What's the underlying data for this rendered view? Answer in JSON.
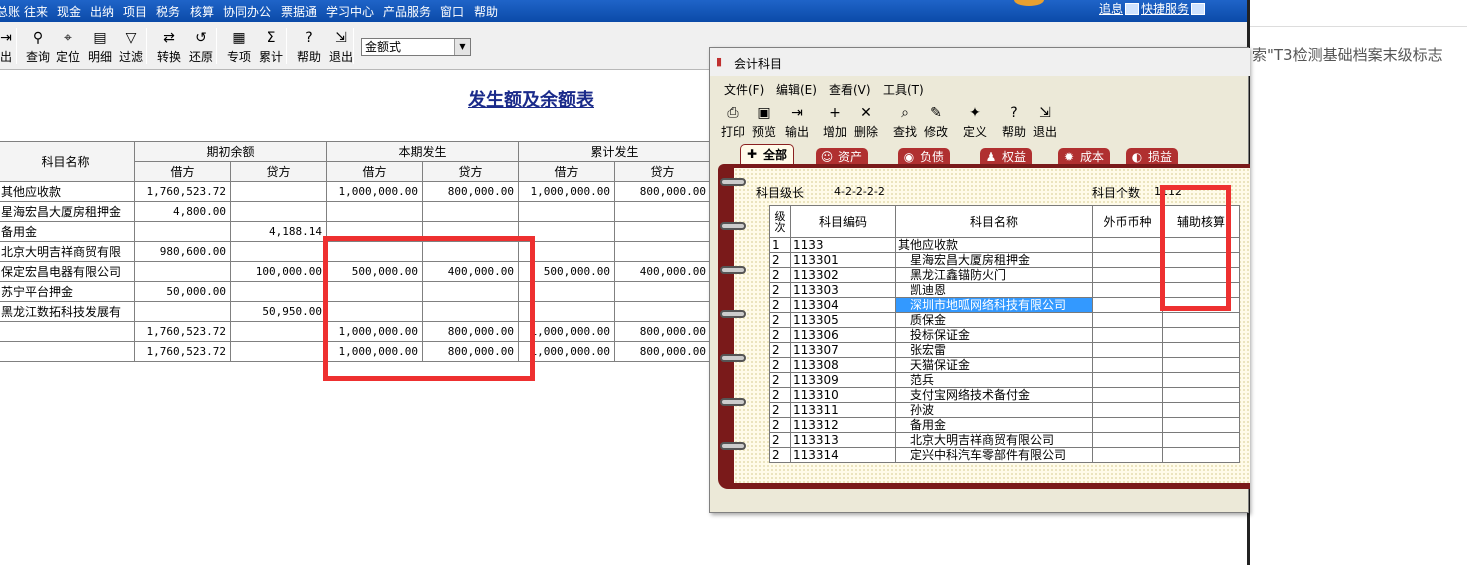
{
  "menu": {
    "items": [
      "总账",
      "往来",
      "现金",
      "出纳",
      "项目",
      "税务",
      "核算",
      "协同办公",
      "票据通",
      "学习中心",
      "产品服务",
      "窗口",
      "帮助"
    ],
    "news": "追息",
    "quick_service": "快捷服务"
  },
  "toolbar": {
    "buttons": [
      {
        "label": "出",
        "icon": "output-icon"
      },
      {
        "label": "查询",
        "icon": "binoculars-icon"
      },
      {
        "label": "定位",
        "icon": "locate-icon"
      },
      {
        "label": "明细",
        "icon": "detail-icon"
      },
      {
        "label": "过滤",
        "icon": "filter-icon"
      },
      {
        "label": "转换",
        "icon": "convert-icon"
      },
      {
        "label": "还原",
        "icon": "restore-icon"
      },
      {
        "label": "专项",
        "icon": "special-icon"
      },
      {
        "label": "累计",
        "icon": "sigma-icon"
      },
      {
        "label": "帮助",
        "icon": "help-icon"
      },
      {
        "label": "退出",
        "icon": "exit-icon"
      }
    ],
    "format_select": "金额式"
  },
  "report": {
    "title": "发生额及余额表",
    "headers": {
      "name": "科目名称",
      "opening": "期初余额",
      "period": "本期发生",
      "cumulative": "累计发生",
      "debit": "借方",
      "credit": "贷方"
    },
    "rows": [
      {
        "name": "其他应收款",
        "od": "1,760,523.72",
        "oc": "",
        "pd": "1,000,000.00",
        "pc": "800,000.00",
        "cd": "1,000,000.00",
        "cc": "800,000.00"
      },
      {
        "name": "星海宏昌大厦房租押金",
        "od": "4,800.00",
        "oc": "",
        "pd": "",
        "pc": "",
        "cd": "",
        "cc": ""
      },
      {
        "name": "备用金",
        "od": "",
        "oc": "4,188.14",
        "pd": "",
        "pc": "",
        "cd": "",
        "cc": ""
      },
      {
        "name": "北京大明吉祥商贸有限",
        "od": "980,600.00",
        "oc": "",
        "pd": "",
        "pc": "",
        "cd": "",
        "cc": ""
      },
      {
        "name": "保定宏昌电器有限公司",
        "od": "",
        "oc": "100,000.00",
        "pd": "500,000.00",
        "pc": "400,000.00",
        "cd": "500,000.00",
        "cc": "400,000.00"
      },
      {
        "name": "苏宁平台押金",
        "od": "50,000.00",
        "oc": "",
        "pd": "",
        "pc": "",
        "cd": "",
        "cc": ""
      },
      {
        "name": "黑龙江数拓科技发展有",
        "od": "",
        "oc": "50,950.00",
        "pd": "",
        "pc": "",
        "cd": "",
        "cc": ""
      },
      {
        "name": "",
        "od": "1,760,523.72",
        "oc": "",
        "pd": "1,000,000.00",
        "pc": "800,000.00",
        "cd": "1,000,000.00",
        "cc": "800,000.00"
      },
      {
        "name": "",
        "od": "1,760,523.72",
        "oc": "",
        "pd": "1,000,000.00",
        "pc": "800,000.00",
        "cd": "1,000,000.00",
        "cc": "800,000.00"
      }
    ]
  },
  "dialog": {
    "title": "会计科目",
    "menu": [
      "文件(F)",
      "编辑(E)",
      "查看(V)",
      "工具(T)"
    ],
    "tools": [
      {
        "label": "打印",
        "icon": "print-icon"
      },
      {
        "label": "预览",
        "icon": "preview-icon"
      },
      {
        "label": "输出",
        "icon": "output-icon"
      },
      {
        "label": "增加",
        "icon": "add-icon"
      },
      {
        "label": "删除",
        "icon": "delete-icon"
      },
      {
        "label": "查找",
        "icon": "find-icon"
      },
      {
        "label": "修改",
        "icon": "edit-icon"
      },
      {
        "label": "定义",
        "icon": "define-icon"
      },
      {
        "label": "帮助",
        "icon": "help-icon"
      },
      {
        "label": "退出",
        "icon": "exit-icon"
      }
    ],
    "tabs": [
      "全部",
      "资产",
      "负债",
      "权益",
      "成本",
      "损益"
    ],
    "level_label": "科目级长",
    "level_value": "4-2-2-2-2",
    "count_label": "科目个数",
    "count_value": "1112",
    "columns": {
      "level": "级次",
      "code": "科目编码",
      "name": "科目名称",
      "currency": "外币币种",
      "aux": "辅助核算"
    },
    "rows": [
      {
        "level": "1",
        "code": "1133",
        "name": "其他应收款"
      },
      {
        "level": "2",
        "code": "113301",
        "name": "星海宏昌大厦房租押金"
      },
      {
        "level": "2",
        "code": "113302",
        "name": "黑龙江鑫锚防火门"
      },
      {
        "level": "2",
        "code": "113303",
        "name": "凯迪恩"
      },
      {
        "level": "2",
        "code": "113304",
        "name": "深圳市地呱网络科技有限公司"
      },
      {
        "level": "2",
        "code": "113305",
        "name": "质保金"
      },
      {
        "level": "2",
        "code": "113306",
        "name": "投标保证金"
      },
      {
        "level": "2",
        "code": "113307",
        "name": "张宏雷"
      },
      {
        "level": "2",
        "code": "113308",
        "name": "天猫保证金"
      },
      {
        "level": "2",
        "code": "113309",
        "name": "范兵"
      },
      {
        "level": "2",
        "code": "113310",
        "name": "支付宝网络技术备付金"
      },
      {
        "level": "2",
        "code": "113311",
        "name": "孙波"
      },
      {
        "level": "2",
        "code": "113312",
        "name": "备用金"
      },
      {
        "level": "2",
        "code": "113313",
        "name": "北京大明吉祥商贸有限公司"
      },
      {
        "level": "2",
        "code": "113314",
        "name": "定兴中科汽车零部件有限公司"
      }
    ],
    "selected_index": 4
  },
  "side_panel": {
    "text": "索\"T3检测基础档案末级标志"
  }
}
